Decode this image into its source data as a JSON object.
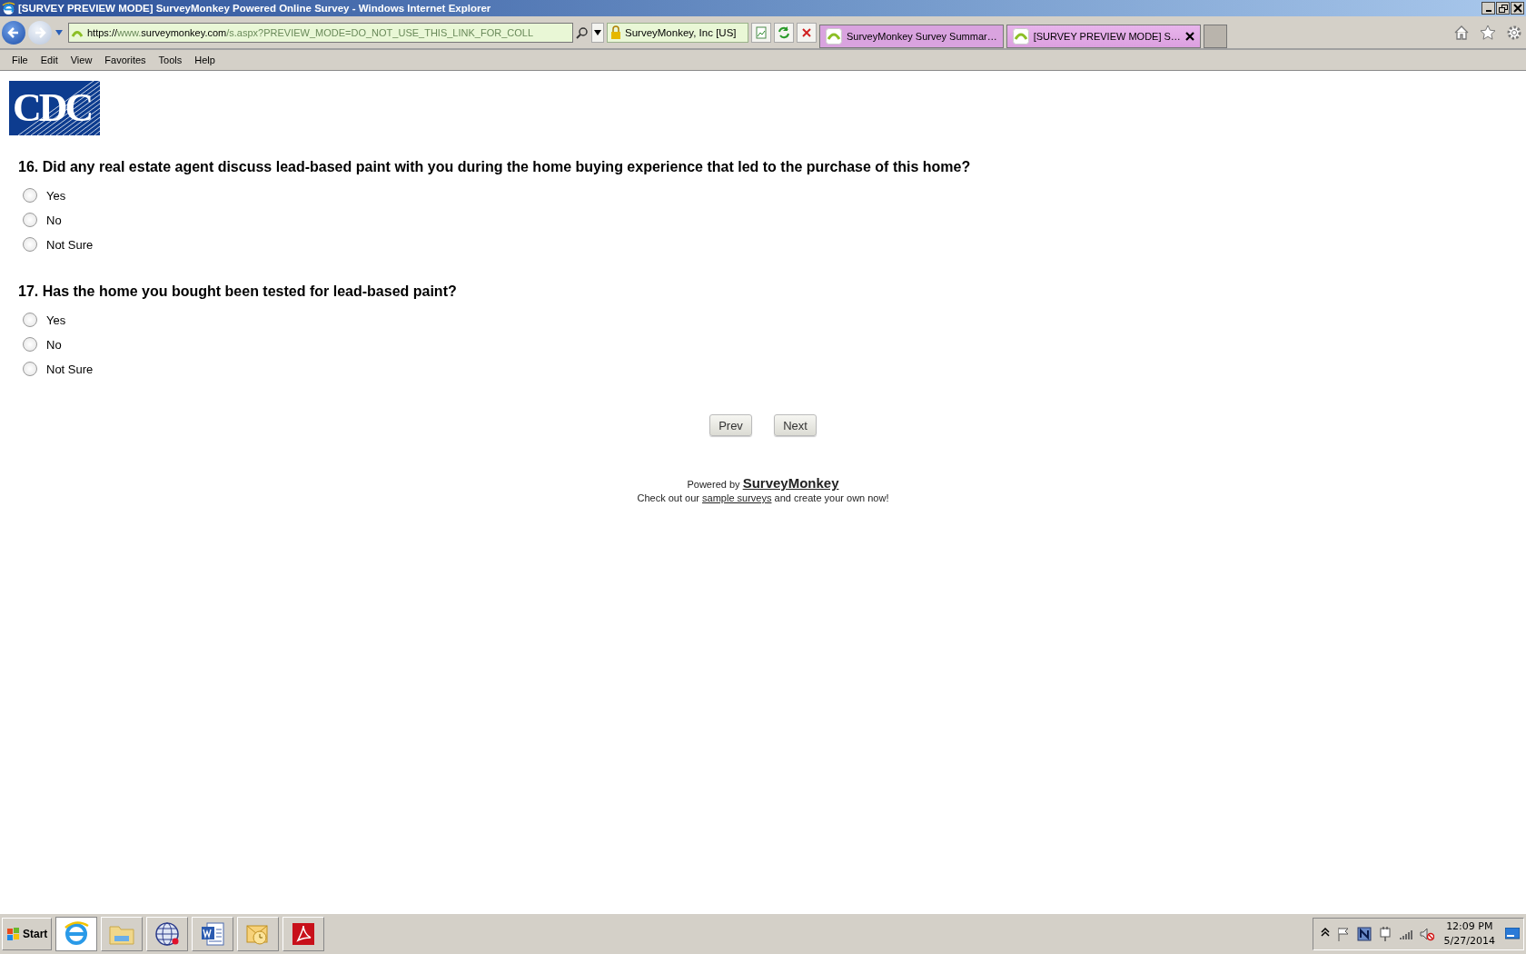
{
  "window": {
    "title": "[SURVEY PREVIEW MODE] SurveyMonkey Powered Online Survey - Windows Internet Explorer"
  },
  "address_bar": {
    "parts": [
      {
        "text": "https://",
        "highlight": true
      },
      {
        "text": "www.",
        "highlight": false
      },
      {
        "text": "surveymonkey.com",
        "highlight": true
      },
      {
        "text": "/s.aspx?PREVIEW_MODE=DO_NOT_USE_THIS_LINK_FOR_COLL",
        "highlight": false
      }
    ]
  },
  "security": "SurveyMonkey, Inc [US]",
  "tabs": [
    {
      "label": "SurveyMonkey Survey Summar…",
      "selected": false
    },
    {
      "label": "[SURVEY PREVIEW MODE] S…",
      "selected": true
    }
  ],
  "menu": [
    "File",
    "Edit",
    "View",
    "Favorites",
    "Tools",
    "Help"
  ],
  "logo": "CDC",
  "questions": [
    {
      "text": "16. Did any real estate agent discuss lead-based paint with you during the home buying experience that led to the purchase of this home?",
      "options": [
        {
          "label": "Yes",
          "selected": false
        },
        {
          "label": "No",
          "selected": false
        },
        {
          "label": "Not Sure",
          "selected": false
        }
      ]
    },
    {
      "text": "17. Has the home you bought been tested for lead-based paint?",
      "options": [
        {
          "label": "Yes",
          "selected": false
        },
        {
          "label": "No",
          "selected": false
        },
        {
          "label": "Not Sure",
          "selected": false
        }
      ]
    }
  ],
  "buttons": [
    "Prev",
    "Next"
  ],
  "footer": {
    "powered_by": "Powered by",
    "brand": "SurveyMonkey",
    "line_start": "Check out our",
    "link": "sample surveys",
    "line_end": "and create your own now!"
  },
  "taskbar": {
    "start": "Start",
    "clock": {
      "time": "12:09 PM",
      "date": "5/27/2014"
    }
  }
}
